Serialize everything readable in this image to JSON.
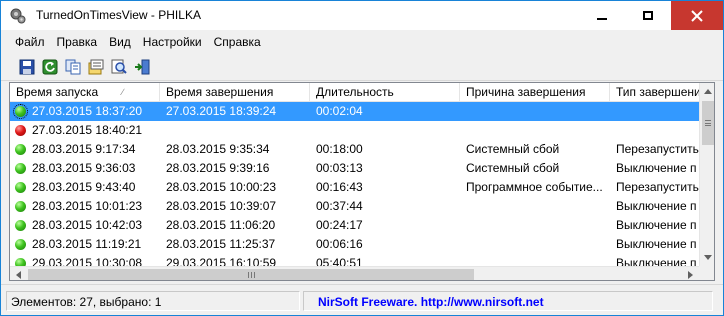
{
  "window": {
    "title": "TurnedOnTimesView  -  PHILKA",
    "icon": "app-icon"
  },
  "menu": [
    {
      "label": "Файл"
    },
    {
      "label": "Правка"
    },
    {
      "label": "Вид"
    },
    {
      "label": "Настройки"
    },
    {
      "label": "Справка"
    }
  ],
  "toolbar": {
    "buttons": [
      {
        "icon": "save-icon"
      },
      {
        "icon": "refresh-icon"
      },
      {
        "icon": "copy-icon"
      },
      {
        "icon": "properties-icon"
      },
      {
        "icon": "find-icon"
      },
      {
        "icon": "exit-icon"
      }
    ]
  },
  "columns": [
    {
      "label": "Время запуска"
    },
    {
      "label": "Время завершения"
    },
    {
      "label": "Длительность"
    },
    {
      "label": "Причина завершения"
    },
    {
      "label": "Тип завершения"
    }
  ],
  "rows": [
    {
      "status": "green",
      "selected": true,
      "start": "27.03.2015 18:37:20",
      "end": "27.03.2015 18:39:24",
      "duration": "00:02:04",
      "reason": "",
      "type": ""
    },
    {
      "status": "red",
      "selected": false,
      "start": "27.03.2015 18:40:21",
      "end": "",
      "duration": "",
      "reason": "",
      "type": ""
    },
    {
      "status": "green",
      "selected": false,
      "start": "28.03.2015 9:17:34",
      "end": "28.03.2015 9:35:34",
      "duration": "00:18:00",
      "reason": "Системный сбой",
      "type": "Перезапустить"
    },
    {
      "status": "green",
      "selected": false,
      "start": "28.03.2015 9:36:03",
      "end": "28.03.2015 9:39:16",
      "duration": "00:03:13",
      "reason": "Системный сбой",
      "type": "Выключение п"
    },
    {
      "status": "green",
      "selected": false,
      "start": "28.03.2015 9:43:40",
      "end": "28.03.2015 10:00:23",
      "duration": "00:16:43",
      "reason": "Программное событие...",
      "type": "Перезапустить"
    },
    {
      "status": "green",
      "selected": false,
      "start": "28.03.2015 10:01:23",
      "end": "28.03.2015 10:39:07",
      "duration": "00:37:44",
      "reason": "",
      "type": "Выключение п"
    },
    {
      "status": "green",
      "selected": false,
      "start": "28.03.2015 10:42:03",
      "end": "28.03.2015 11:06:20",
      "duration": "00:24:17",
      "reason": "",
      "type": "Выключение п"
    },
    {
      "status": "green",
      "selected": false,
      "start": "28.03.2015 11:19:21",
      "end": "28.03.2015 11:25:37",
      "duration": "00:06:16",
      "reason": "",
      "type": "Выключение п"
    },
    {
      "status": "green",
      "selected": false,
      "start": "29.03.2015 10:30:08",
      "end": "29.03.2015 16:10:59",
      "duration": "05:40:51",
      "reason": "",
      "type": "Выключение п"
    }
  ],
  "status": {
    "count_text": "Элементов: 27, выбрано: 1",
    "link_text": "NirSoft Freeware.  http://www.nirsoft.net"
  },
  "colors": {
    "selection": "#3399ff",
    "close_button": "#c7372f",
    "link": "#0000ff"
  }
}
